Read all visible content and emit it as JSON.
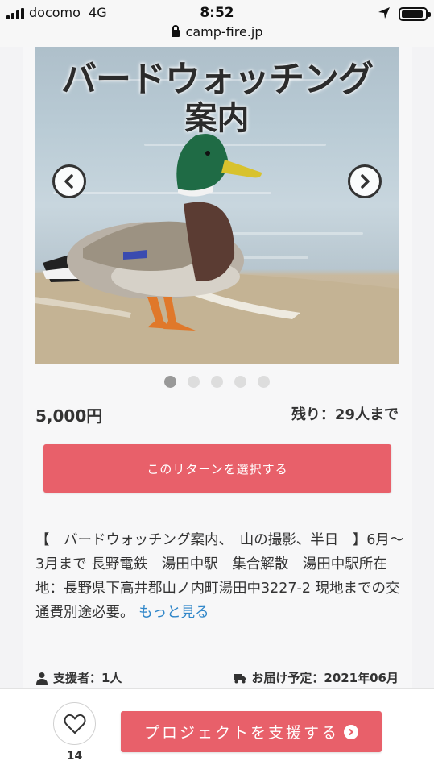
{
  "status_bar": {
    "carrier": "docomo",
    "network": "4G",
    "time": "8:52",
    "url": "camp-fire.jp"
  },
  "hero": {
    "title_line1": "バードウォッチング",
    "title_line2": "案内",
    "image_subject": "duck-photo",
    "slide_count": 5,
    "active_slide": 1
  },
  "reward": {
    "price": "5,000円",
    "remaining": "残り：29人まで",
    "select_label": "このリターンを選択する",
    "description": "【　バードウォッチング案内、　山の撮影、半日　】6月〜3月まで 長野電鉄　湯田中駅　集合解散　湯田中駅所在地：長野県下高井郡山ノ内町湯田中3227-2 現地までの交通費別途必要。",
    "more_link": "もっと見る",
    "supporters": "支援者：1人",
    "delivery": "お届け予定：2021年06月"
  },
  "bottom_bar": {
    "like_count": "14",
    "support_label": "プロジェクトを支援する"
  },
  "colors": {
    "accent": "#e8606a",
    "link": "#2f86c9"
  }
}
